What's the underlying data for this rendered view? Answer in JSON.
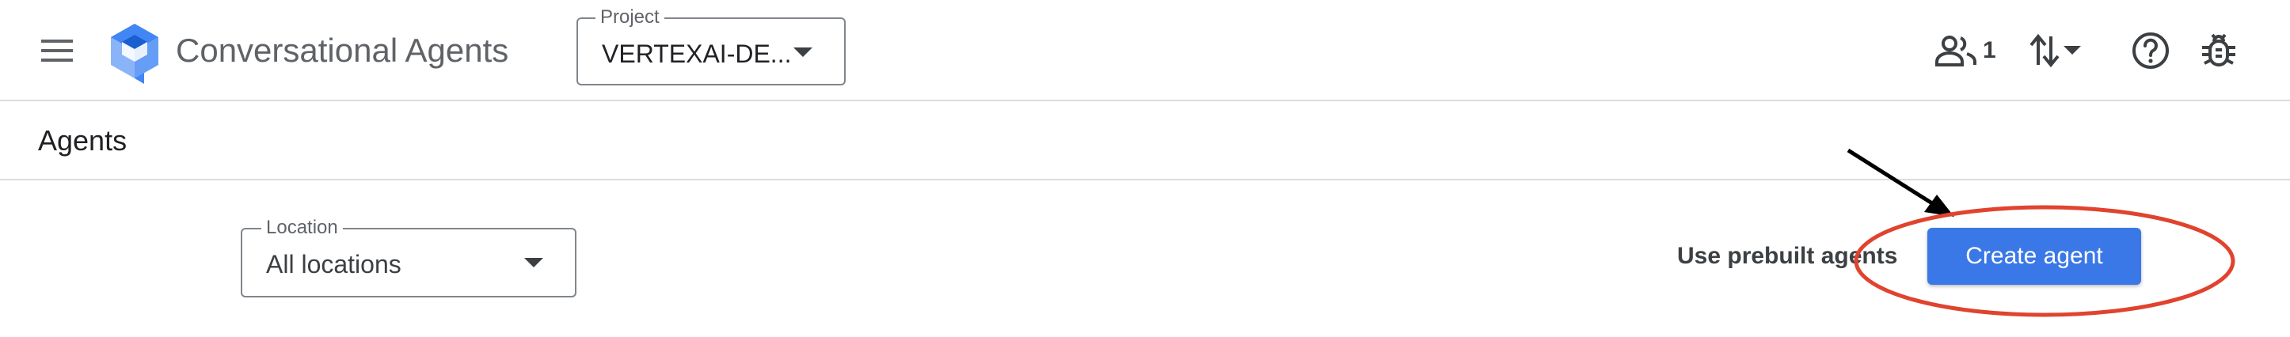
{
  "header": {
    "menu_icon": "hamburger-menu-icon",
    "logo_icon": "dialogflow-logo-icon",
    "app_title": "Conversational Agents",
    "project": {
      "label": "Project",
      "value": "VERTEXAI-DE..."
    },
    "actions": {
      "users_icon": "people-icon",
      "users_count": "1",
      "sort_icon": "swap-vert-icon",
      "help_icon": "help-circle-icon",
      "bug_icon": "bug-report-icon"
    }
  },
  "page": {
    "title": "Agents"
  },
  "toolbar": {
    "location": {
      "label": "Location",
      "value": "All locations"
    },
    "prebuilt_label": "Use prebuilt agents",
    "create_label": "Create agent"
  },
  "colors": {
    "primary": "#3b78e7",
    "annotation_red": "#e0432e",
    "text_muted": "#5f6368",
    "border": "#dadce0"
  }
}
